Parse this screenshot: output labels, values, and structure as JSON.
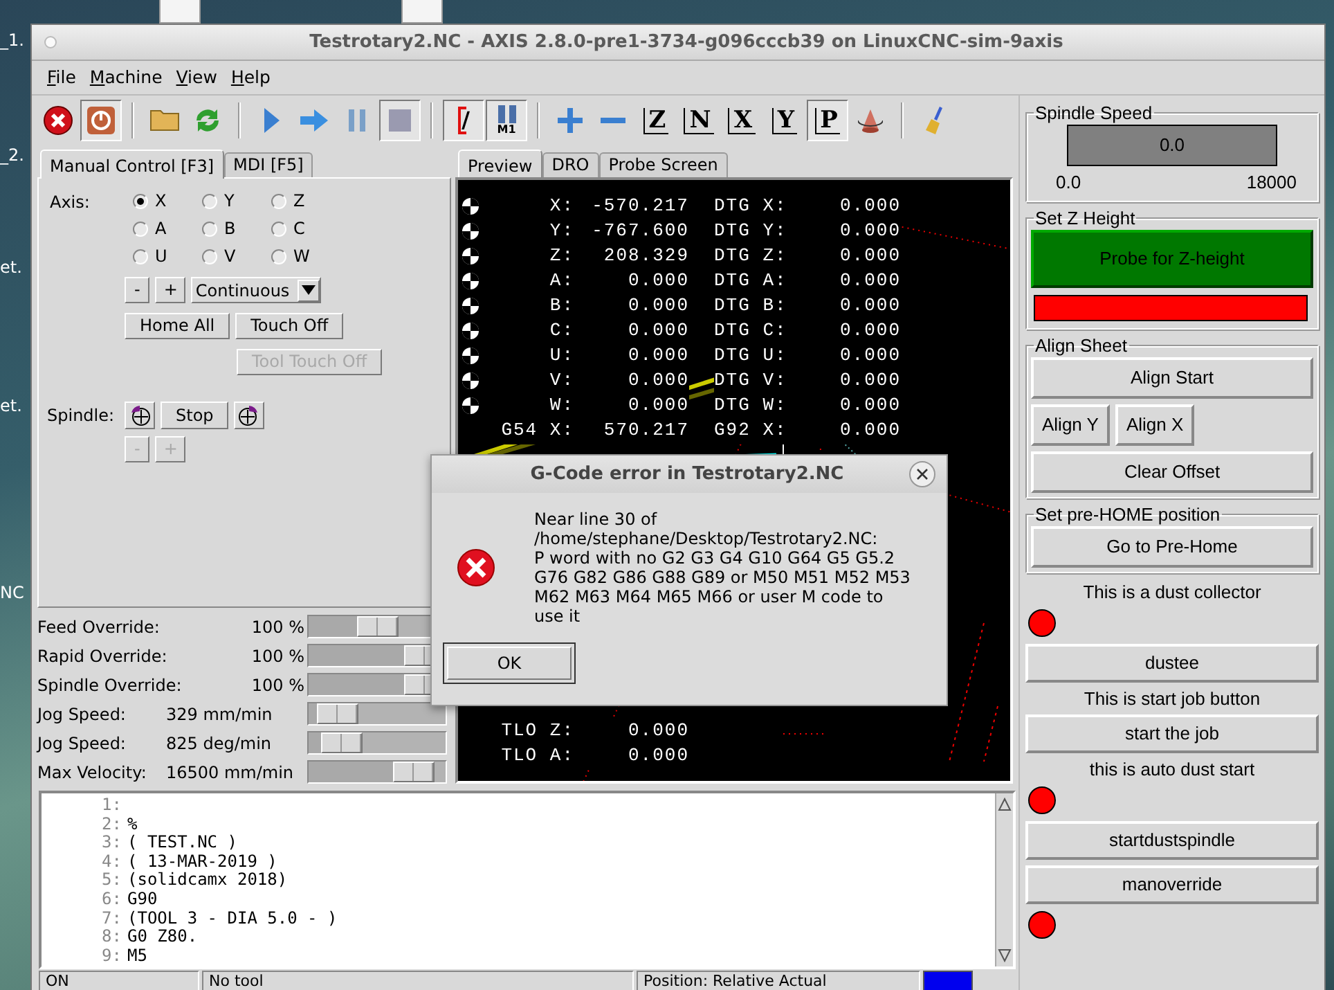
{
  "desktop": {
    "icon_labels": [
      "_1.",
      "_2.",
      "et.",
      "et.",
      "NC"
    ]
  },
  "window": {
    "title": "Testrotary2.NC - AXIS 2.8.0-pre1-3734-g096cccb39 on LinuxCNC-sim-9axis"
  },
  "menu": [
    {
      "label": "File"
    },
    {
      "label": "Machine"
    },
    {
      "label": "View"
    },
    {
      "label": "Help"
    }
  ],
  "toolbar": [
    {
      "kind": "estop",
      "pressed": false
    },
    {
      "kind": "power",
      "pressed": true
    },
    {
      "kind": "separator"
    },
    {
      "kind": "open",
      "pressed": false
    },
    {
      "kind": "reload",
      "pressed": false
    },
    {
      "kind": "separator"
    },
    {
      "kind": "run",
      "pressed": false
    },
    {
      "kind": "step",
      "pressed": false
    },
    {
      "kind": "pause",
      "pressed": false
    },
    {
      "kind": "stop",
      "pressed": true
    },
    {
      "kind": "separator"
    },
    {
      "kind": "block_delete",
      "pressed": true,
      "glyph": "/"
    },
    {
      "kind": "optional_stop",
      "pressed": true,
      "glyph": "M1"
    },
    {
      "kind": "separator"
    },
    {
      "kind": "zoom_in",
      "pressed": false
    },
    {
      "kind": "zoom_out",
      "pressed": false
    },
    {
      "kind": "view",
      "pressed": false,
      "glyph": "Z"
    },
    {
      "kind": "view",
      "pressed": false,
      "glyph": "N"
    },
    {
      "kind": "view",
      "pressed": false,
      "glyph": "X"
    },
    {
      "kind": "view",
      "pressed": false,
      "glyph": "Y"
    },
    {
      "kind": "view",
      "pressed": true,
      "glyph": "P"
    },
    {
      "kind": "rotate",
      "pressed": false
    },
    {
      "kind": "separator"
    },
    {
      "kind": "clear",
      "pressed": false
    }
  ],
  "control_tabs": [
    {
      "label": "Manual Control [F3]",
      "selected": true
    },
    {
      "label": "MDI [F5]",
      "selected": false
    }
  ],
  "manual_control": {
    "axis_label": "Axis:",
    "axes": [
      {
        "label": "X",
        "selected": true
      },
      {
        "label": "Y",
        "selected": false
      },
      {
        "label": "Z",
        "selected": false
      },
      {
        "label": "A",
        "selected": false
      },
      {
        "label": "B",
        "selected": false
      },
      {
        "label": "C",
        "selected": false
      },
      {
        "label": "U",
        "selected": false
      },
      {
        "label": "V",
        "selected": false
      },
      {
        "label": "W",
        "selected": false
      }
    ],
    "jog_minus": "-",
    "jog_plus": "+",
    "jog_mode": "Continuous",
    "home_all": "Home All",
    "touch_off": "Touch Off",
    "tool_touch_off": {
      "label": "Tool Touch Off",
      "disabled": true
    },
    "spindle_label": "Spindle:",
    "spindle_stop": "Stop",
    "spindle_minus": {
      "label": "-",
      "disabled": true
    },
    "spindle_plus": {
      "label": "+",
      "disabled": true
    }
  },
  "overrides": [
    {
      "kind": "override",
      "label": "Feed Override:",
      "reading": "100 %",
      "level": 0.5
    },
    {
      "kind": "override",
      "label": "Rapid Override:",
      "reading": "100 %",
      "level": 1
    },
    {
      "kind": "override",
      "label": "Spindle Override:",
      "reading": "100 %",
      "level": 1
    },
    {
      "kind": "speed",
      "label": "Jog Speed:",
      "reading": "329 mm/min",
      "level": 0.08
    },
    {
      "kind": "speed",
      "label": "Jog Speed:",
      "reading": "825 deg/min",
      "level": 0.13
    },
    {
      "kind": "speed",
      "label": "Max Velocity:",
      "reading": "16500 mm/min",
      "level": 0.89
    }
  ],
  "preview_tabs": [
    {
      "label": "Preview",
      "selected": true
    },
    {
      "label": "DRO",
      "selected": false
    },
    {
      "label": "Probe Screen",
      "selected": false
    }
  ],
  "dro": {
    "upper_rows": [
      {
        "homed": true,
        "label": "X:",
        "value": "-570.217",
        "label2": "DTG X:",
        "value2": "0.000"
      },
      {
        "homed": true,
        "label": "Y:",
        "value": "-767.600",
        "label2": "DTG Y:",
        "value2": "0.000"
      },
      {
        "homed": true,
        "label": "Z:",
        "value": "208.329",
        "label2": "DTG Z:",
        "value2": "0.000"
      },
      {
        "homed": true,
        "label": "A:",
        "value": "0.000",
        "label2": "DTG A:",
        "value2": "0.000"
      },
      {
        "homed": true,
        "label": "B:",
        "value": "0.000",
        "label2": "DTG B:",
        "value2": "0.000"
      },
      {
        "homed": true,
        "label": "C:",
        "value": "0.000",
        "label2": "DTG C:",
        "value2": "0.000"
      },
      {
        "homed": true,
        "label": "U:",
        "value": "0.000",
        "label2": "DTG U:",
        "value2": "0.000"
      },
      {
        "homed": true,
        "label": "V:",
        "value": "0.000",
        "label2": "DTG V:",
        "value2": "0.000"
      },
      {
        "homed": true,
        "label": "W:",
        "value": "0.000",
        "label2": "DTG W:",
        "value2": "0.000"
      },
      {
        "label": "G54 X:",
        "value": "570.217",
        "label2": "G92 X:",
        "value2": "0.000"
      }
    ],
    "lower_rows": [
      {
        "label": "TLO Z:",
        "value": "0.000"
      },
      {
        "label": "TLO A:",
        "value": "0.000"
      }
    ]
  },
  "dialog": {
    "title": "G-Code error in Testrotary2.NC",
    "message": "Near line 30 of\n/home/stephane/Desktop/Testrotary2.NC:\nP word with no G2 G3 G4 G10 G64 G5 G5.2 G76 G82 G86 G88 G89 or M50 M51 M52 M53 M62 M63 M64 M65 M66 or user M code to use it",
    "button": "OK"
  },
  "gcode": [
    {
      "number": "1:"
    },
    {
      "number": "2:",
      "text": "%"
    },
    {
      "number": "3:",
      "text": "( TEST.NC )"
    },
    {
      "number": "4:",
      "text": "( 13-MAR-2019 )"
    },
    {
      "number": "5:",
      "text": "(solidcamx 2018)"
    },
    {
      "number": "6:",
      "text": "G90"
    },
    {
      "number": "7:",
      "text": "(TOOL 3 - DIA 5.0 - )"
    },
    {
      "number": "8:",
      "text": "G0 Z80."
    },
    {
      "number": "9:",
      "text": "M5"
    }
  ],
  "status_bar": [
    "ON",
    "No tool",
    "Position: Relative Actual"
  ],
  "right_panel": {
    "spindle_speed": {
      "title": "Spindle Speed",
      "reading": "0.0",
      "level": 0,
      "min": "0.0",
      "max": "18000"
    },
    "z_height": {
      "title": "Set Z Height",
      "button": "Probe for Z-height"
    },
    "align": {
      "title": "Align Sheet",
      "start": "Align Start",
      "align_y": "Align Y",
      "align_x": "Align X",
      "clear": "Clear Offset"
    },
    "prehome": {
      "title": "Set pre-HOME position",
      "button": "Go to Pre-Home"
    },
    "items": [
      {
        "kind": "caption",
        "text": "This is a dust collector"
      },
      {
        "kind": "led"
      },
      {
        "kind": "button",
        "text": "dustee"
      },
      {
        "kind": "caption",
        "text": "This is start job button"
      },
      {
        "kind": "button",
        "text": "start the job"
      },
      {
        "kind": "caption",
        "text": "this is auto dust start"
      },
      {
        "kind": "led"
      },
      {
        "kind": "button",
        "text": "startdustspindle"
      },
      {
        "kind": "button",
        "text": "manoverride"
      },
      {
        "kind": "led"
      }
    ]
  }
}
